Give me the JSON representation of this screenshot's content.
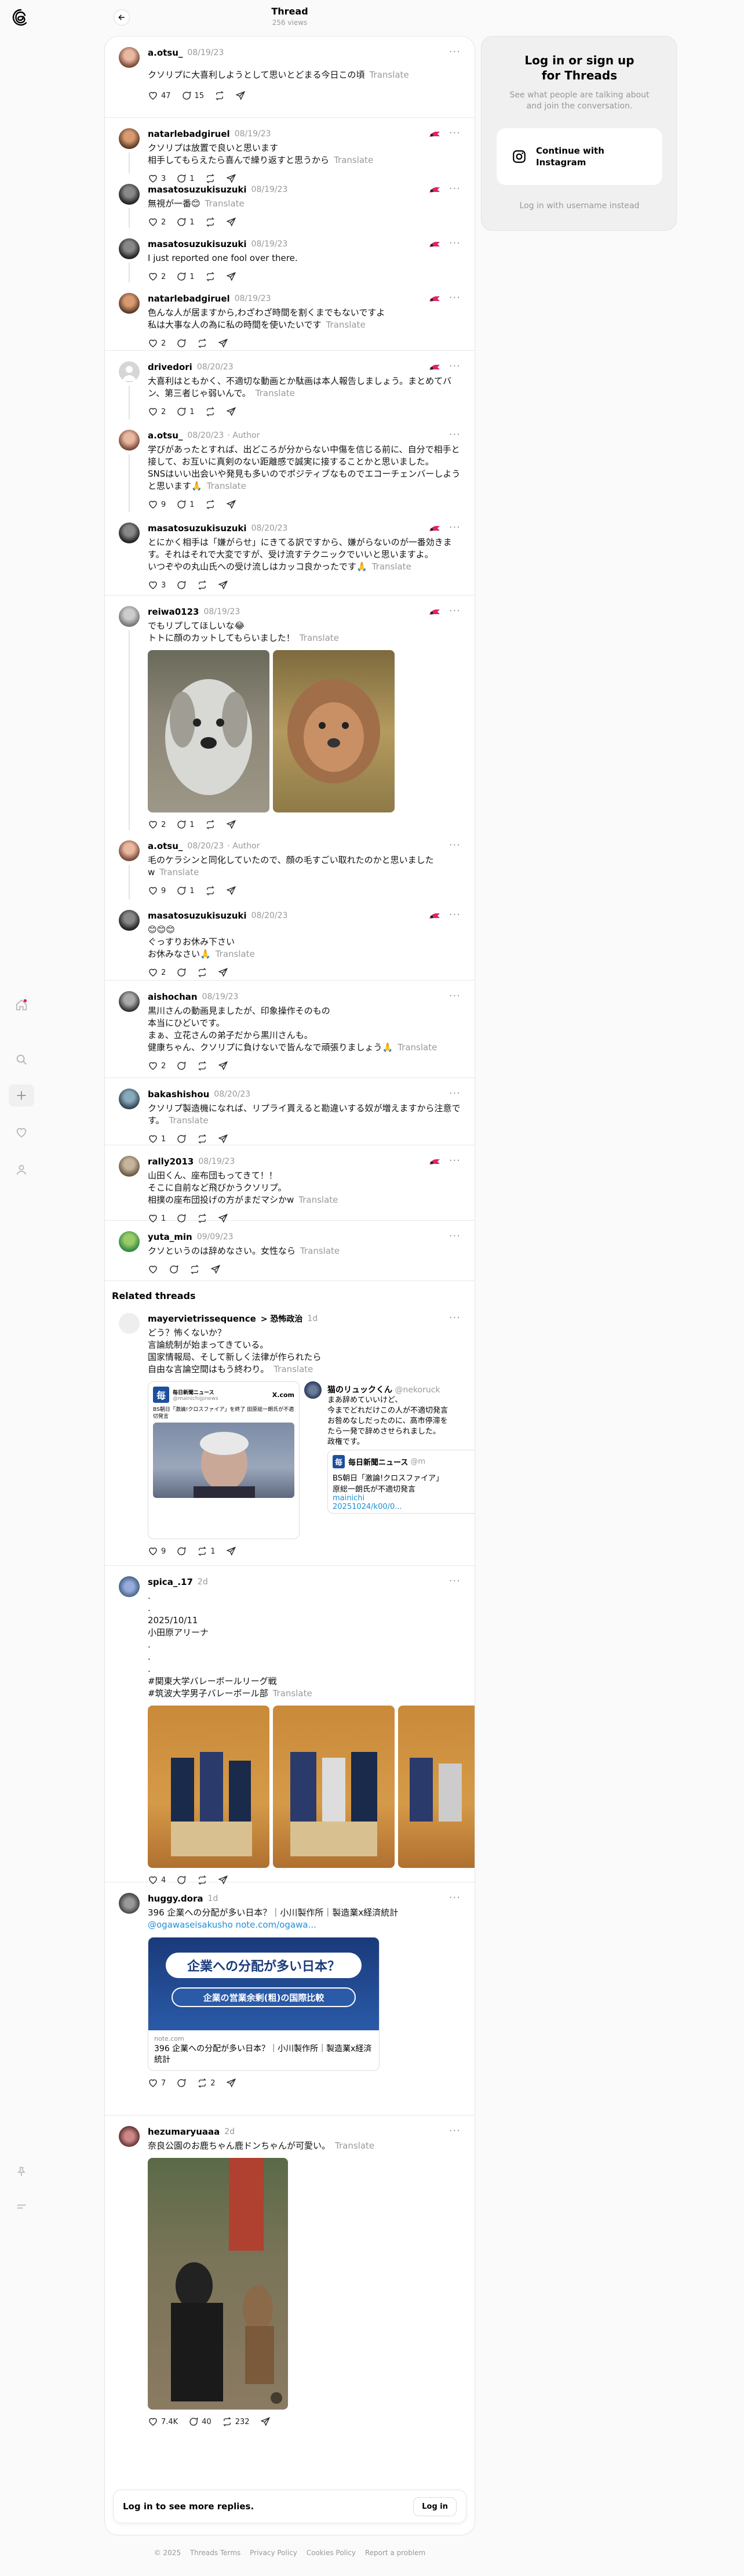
{
  "header": {
    "title": "Thread",
    "views": "256 views"
  },
  "sidebar": {
    "items": [
      "threads-logo-icon",
      "home-icon",
      "search-icon",
      "create-icon",
      "heart-icon",
      "profile-icon",
      "pin-icon",
      "menu-icon"
    ]
  },
  "aside": {
    "title": "Log in or sign up\nfor Threads",
    "subtitle": "See what people are talking about\nand join the conversation.",
    "instagram_button": "Continue with\nInstagram",
    "username_link": "Log in with username instead"
  },
  "translate_label": "Translate",
  "author_label": "· Author",
  "posts": [
    {
      "user": "a.otsu_",
      "date": "08/19/23",
      "text": "クソリプに大喜利しようとして思いとどまる今日この頃",
      "likes": "47",
      "replies": "15",
      "reposts": "",
      "shares": ""
    },
    {
      "user": "natarlebadgiruel",
      "date": "08/19/23",
      "text": "クソリプは放置で良いと思います\n相手してもらえたら喜んで繰り返すと思うから",
      "likes": "3",
      "replies": "1",
      "reposts": "",
      "shares": ""
    },
    {
      "user": "masatosuzukisuzuki",
      "date": "08/19/23",
      "text": "無視が一番😊",
      "likes": "2",
      "replies": "1",
      "reposts": "",
      "shares": ""
    },
    {
      "user": "masatosuzukisuzuki",
      "date": "08/19/23",
      "text": "I just reported one fool over there.",
      "likes": "2",
      "replies": "1",
      "reposts": "",
      "shares": ""
    },
    {
      "user": "natarlebadgiruel",
      "date": "08/19/23",
      "text": "色んな人が居ますから,わざわざ時間を割くまでもないですよ\n私は大事な人の為に私の時間を使いたいです",
      "likes": "2",
      "replies": "",
      "reposts": "",
      "shares": ""
    },
    {
      "user": "drivedori",
      "date": "08/20/23",
      "text": "大喜利はともかく、不適切な動画とか駄画は本人報告しましょう。まとめてバン、第三者じゃ弱いんで。",
      "likes": "2",
      "replies": "1",
      "reposts": "",
      "shares": ""
    },
    {
      "user": "a.otsu_",
      "date": "08/20/23",
      "text": "学びがあったとすれば、出どころが分からない中傷を信じる前に、自分で相手と接して、お互いに真剣のない距離感で誠実に接することかと思いました。\nSNSはいい出会いや発見も多いのでポジティブなものでエコーチェンバーしようと思います🙏",
      "likes": "9",
      "replies": "1",
      "reposts": "",
      "shares": ""
    },
    {
      "user": "masatosuzukisuzuki",
      "date": "08/20/23",
      "text": "とにかく相手は「嫌がらせ」にきてる訳ですから、嫌がらないのが一番効きます。それはそれで大変ですが、受け流すテクニックでいいと思いますよ。\nいつぞやの丸山氏への受け流しはカッコ良かったです🙏",
      "likes": "3",
      "replies": "",
      "reposts": "",
      "shares": ""
    },
    {
      "user": "reiwa0123",
      "date": "08/19/23",
      "text": "でもリプしてほしいな😂\nトトに顔のカットしてもらいました！",
      "likes": "2",
      "replies": "1",
      "reposts": "",
      "shares": ""
    },
    {
      "user": "a.otsu_",
      "date": "08/20/23",
      "text": "毛のケラシンと同化していたので、顔の毛すごい取れたのかと思いました\nw",
      "likes": "9",
      "replies": "1",
      "reposts": "",
      "shares": ""
    },
    {
      "user": "masatosuzukisuzuki",
      "date": "08/20/23",
      "text": "😊😊😊\nぐっすりお休み下さい\nお休みなさい🙏",
      "likes": "2",
      "replies": "",
      "reposts": "",
      "shares": ""
    },
    {
      "user": "aishochan",
      "date": "08/19/23",
      "text": "黒川さんの動画見ましたが、印象操作そのもの\n本当にひどいです。\nまぁ、立花さんの弟子だから黒川さんも。\n健康ちゃん、クソリプに負けないで皆んなで頑張りましょう🙏",
      "likes": "2",
      "replies": "",
      "reposts": "",
      "shares": ""
    },
    {
      "user": "bakashishou",
      "date": "08/20/23",
      "text": "クソリプ製造機になれば、リプライ貰えると勘違いする奴が増えますから注意です。",
      "likes": "1",
      "replies": "",
      "reposts": "",
      "shares": ""
    },
    {
      "user": "rally2013",
      "date": "08/19/23",
      "text": "山田くん、座布団もってきて！！\nそこに自前など飛びかうクソリプ。\n相撲の座布団投げの方がまだマシかw",
      "likes": "1",
      "replies": "",
      "reposts": "",
      "shares": ""
    },
    {
      "user": "yuta_min",
      "date": "09/09/23",
      "text": "クソというのは辞めなさい。女性なら",
      "likes": "",
      "replies": "",
      "reposts": "",
      "shares": ""
    }
  ],
  "related": {
    "title": "Related threads",
    "posts": [
      {
        "user": "mayervietrissequence",
        "topic": "> 恐怖政治",
        "date": "1d",
        "text": "どう？怖くないか？\n言論統制が始まってきている。\n国家情報局、そして新しく法律が作られたら\n自由な言論空間はもう終わり。",
        "likes": "9",
        "replies": "",
        "reposts": "1",
        "shares": "",
        "embed": {
          "source": "毎日新聞ニュース",
          "handle": "@mainichijpnews",
          "site": "X.com",
          "headline": "BS朝日「激論!クロスファイア」を終了 田原総一朗氏が不適切発言",
          "quote_user": "猫のリュックくん",
          "quote_handle": "@nekoruck",
          "quote_text": "まあ辞めていいけど、\n今までどれだけこの人が不適切発言\nお咎めなしだったのに、高市停滞を\nたら一発で辞めさせられました。\n政権です。",
          "quote_src": "毎日新聞ニュース",
          "quote_news": "BS朝日「激論!クロスファイア」",
          "quote_news2": "原総一朗氏が不適切発言",
          "quote_link": "mainichi",
          "quote_link2": "20251024/k00/0..."
        }
      },
      {
        "user": "spica_.17",
        "date": "2d",
        "text": ".\n.\n2025/10/11\n小田原アリーナ\n.\n.\n.\n#関東大学バレーボールリーグ戦\n#筑波大学男子バレーボール部",
        "likes": "4",
        "replies": "",
        "reposts": "",
        "shares": ""
      },
      {
        "user": "huggy.dora",
        "date": "1d",
        "text": "396 企業への分配が多い日本？｜小川製作所｜製造業x経済統計",
        "link": "@ogawaseisakusho note.com/ogawa...",
        "card_banner": "企業への分配が多い日本？",
        "card_sub": "企業の営業余剰(粗)の国際比較",
        "card_site": "note.com",
        "card_title": "396 企業への分配が多い日本？｜小川製作所｜製造業x経済統計",
        "likes": "7",
        "replies": "",
        "reposts": "2",
        "shares": ""
      },
      {
        "user": "hezumaryuaaa",
        "date": "2d",
        "text": "奈良公園のお鹿ちゃん鹿ドンちゃんが可愛い。",
        "likes": "7.4K",
        "replies": "40",
        "reposts": "232",
        "shares": ""
      }
    ]
  },
  "login_bar": {
    "text": "Log in to see more replies.",
    "button": "Log in"
  },
  "footer": [
    "© 2025",
    "Threads Terms",
    "Privacy Policy",
    "Cookies Policy",
    "Report a problem"
  ],
  "colors": {
    "accent_blue": "#1d8fd6",
    "flag_red": "#e0245e"
  }
}
